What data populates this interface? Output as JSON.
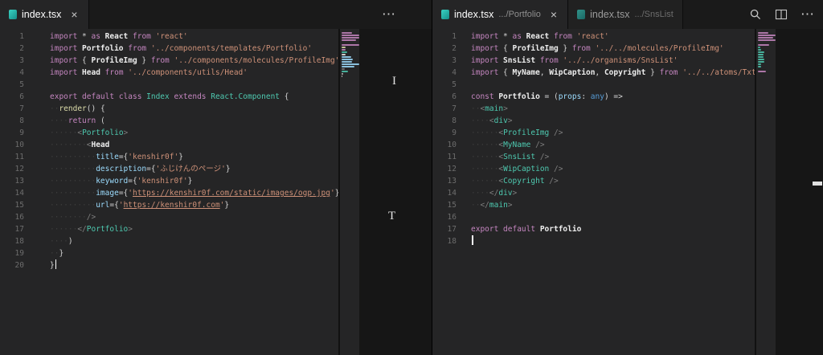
{
  "icons": {
    "close": "×",
    "more": "⋯"
  },
  "colors": {
    "keyword": "#c586c0",
    "string": "#ce9178",
    "component": "#4ec9b0",
    "attribute": "#9cdcfe",
    "type": "#569cd6",
    "editor_bg": "#252526"
  },
  "left_group": {
    "tabs": [
      {
        "title": "index.tsx",
        "active": true
      }
    ],
    "overlay_glyphs": [
      "I",
      "T"
    ],
    "editor": {
      "cursor_line": 20,
      "lines": [
        [
          [
            "kw",
            "import "
          ],
          [
            "pun",
            "* "
          ],
          [
            "kw",
            "as "
          ],
          [
            "id",
            "React "
          ],
          [
            "kw",
            "from "
          ],
          [
            "str",
            "'react'"
          ]
        ],
        [
          [
            "kw",
            "import "
          ],
          [
            "id",
            "Portfolio "
          ],
          [
            "kw",
            "from "
          ],
          [
            "str",
            "'../components/templates/Portfolio'"
          ]
        ],
        [
          [
            "kw",
            "import "
          ],
          [
            "pun",
            "{ "
          ],
          [
            "id",
            "ProfileImg"
          ],
          [
            "pun",
            " } "
          ],
          [
            "kw",
            "from "
          ],
          [
            "str",
            "'../components/molecules/ProfileImg'"
          ]
        ],
        [
          [
            "kw",
            "import "
          ],
          [
            "id",
            "Head "
          ],
          [
            "kw",
            "from "
          ],
          [
            "str",
            "'../components/utils/Head'"
          ]
        ],
        [],
        [
          [
            "kw",
            "export "
          ],
          [
            "kw",
            "default "
          ],
          [
            "kw",
            "class "
          ],
          [
            "comp",
            "Index "
          ],
          [
            "kw",
            "extends "
          ],
          [
            "comp",
            "React.Component "
          ],
          [
            "pun",
            "{"
          ]
        ],
        [
          [
            "ws",
            "··"
          ],
          [
            "fn",
            "render"
          ],
          [
            "pun",
            "() {"
          ]
        ],
        [
          [
            "ws",
            "····"
          ],
          [
            "kw",
            "return "
          ],
          [
            "pun",
            "("
          ]
        ],
        [
          [
            "ws",
            "······"
          ],
          [
            "tag",
            "<"
          ],
          [
            "comp",
            "Portfolio"
          ],
          [
            "tag",
            ">"
          ]
        ],
        [
          [
            "ws",
            "········"
          ],
          [
            "tag",
            "<"
          ],
          [
            "id",
            "Head"
          ]
        ],
        [
          [
            "ws",
            "··········"
          ],
          [
            "attr",
            "title"
          ],
          [
            "pun",
            "={"
          ],
          [
            "str",
            "'kenshir0f'"
          ],
          [
            "pun",
            "}"
          ]
        ],
        [
          [
            "ws",
            "··········"
          ],
          [
            "attr",
            "description"
          ],
          [
            "pun",
            "={"
          ],
          [
            "str",
            "'ふじけんのページ'"
          ],
          [
            "pun",
            "}"
          ]
        ],
        [
          [
            "ws",
            "··········"
          ],
          [
            "attr",
            "keyword"
          ],
          [
            "pun",
            "={"
          ],
          [
            "str",
            "'kenshir0f'"
          ],
          [
            "pun",
            "}"
          ]
        ],
        [
          [
            "ws",
            "··········"
          ],
          [
            "attr",
            "image"
          ],
          [
            "pun",
            "={"
          ],
          [
            "str",
            "'"
          ],
          [
            "link",
            "https://kenshir0f.com/static/images/ogp.jpg"
          ],
          [
            "str",
            "'"
          ],
          [
            "pun",
            "}"
          ]
        ],
        [
          [
            "ws",
            "··········"
          ],
          [
            "attr",
            "url"
          ],
          [
            "pun",
            "={"
          ],
          [
            "str",
            "'"
          ],
          [
            "link",
            "https://kenshir0f.com"
          ],
          [
            "str",
            "'"
          ],
          [
            "pun",
            "}"
          ]
        ],
        [
          [
            "ws",
            "········"
          ],
          [
            "tag",
            "/>"
          ]
        ],
        [
          [
            "ws",
            "······"
          ],
          [
            "tag",
            "</"
          ],
          [
            "comp",
            "Portfolio"
          ],
          [
            "tag",
            ">"
          ]
        ],
        [
          [
            "ws",
            "····"
          ],
          [
            "pun",
            ")"
          ]
        ],
        [
          [
            "ws",
            "··"
          ],
          [
            "pun",
            "}"
          ]
        ],
        [
          [
            "pun",
            "}"
          ]
        ]
      ]
    }
  },
  "right_group": {
    "tabs": [
      {
        "title": "index.tsx",
        "description": ".../Portfolio",
        "active": true
      },
      {
        "title": "index.tsx",
        "description": ".../SnsList",
        "active": false
      }
    ],
    "editor": {
      "cursor_line": 18,
      "lines": [
        [
          [
            "kw",
            "import "
          ],
          [
            "pun",
            "* "
          ],
          [
            "kw",
            "as "
          ],
          [
            "id",
            "React "
          ],
          [
            "kw",
            "from "
          ],
          [
            "str",
            "'react'"
          ]
        ],
        [
          [
            "kw",
            "import "
          ],
          [
            "pun",
            "{ "
          ],
          [
            "id",
            "ProfileImg"
          ],
          [
            "pun",
            " } "
          ],
          [
            "kw",
            "from "
          ],
          [
            "str",
            "'../../molecules/ProfileImg'"
          ]
        ],
        [
          [
            "kw",
            "import "
          ],
          [
            "id",
            "SnsList "
          ],
          [
            "kw",
            "from "
          ],
          [
            "str",
            "'../../organisms/SnsList'"
          ]
        ],
        [
          [
            "kw",
            "import "
          ],
          [
            "pun",
            "{ "
          ],
          [
            "id",
            "MyName"
          ],
          [
            "pun",
            ", "
          ],
          [
            "id",
            "WipCaption"
          ],
          [
            "pun",
            ", "
          ],
          [
            "id",
            "Copyright"
          ],
          [
            "pun",
            " } "
          ],
          [
            "kw",
            "from "
          ],
          [
            "str",
            "'../../atoms/Txt'"
          ]
        ],
        [],
        [
          [
            "kw",
            "const "
          ],
          [
            "id",
            "Portfolio "
          ],
          [
            "pun",
            "= ("
          ],
          [
            "attr",
            "props"
          ],
          [
            "pun",
            ": "
          ],
          [
            "type",
            "any"
          ],
          [
            "pun",
            ") =>"
          ]
        ],
        [
          [
            "ws",
            "··"
          ],
          [
            "tag",
            "<"
          ],
          [
            "comp",
            "main"
          ],
          [
            "tag",
            ">"
          ]
        ],
        [
          [
            "ws",
            "····"
          ],
          [
            "tag",
            "<"
          ],
          [
            "comp",
            "div"
          ],
          [
            "tag",
            ">"
          ]
        ],
        [
          [
            "ws",
            "······"
          ],
          [
            "tag",
            "<"
          ],
          [
            "comp",
            "ProfileImg"
          ],
          [
            "tag",
            " />"
          ]
        ],
        [
          [
            "ws",
            "······"
          ],
          [
            "tag",
            "<"
          ],
          [
            "comp",
            "MyName"
          ],
          [
            "tag",
            " />"
          ]
        ],
        [
          [
            "ws",
            "······"
          ],
          [
            "tag",
            "<"
          ],
          [
            "comp",
            "SnsList"
          ],
          [
            "tag",
            " />"
          ]
        ],
        [
          [
            "ws",
            "······"
          ],
          [
            "tag",
            "<"
          ],
          [
            "comp",
            "WipCaption"
          ],
          [
            "tag",
            " />"
          ]
        ],
        [
          [
            "ws",
            "······"
          ],
          [
            "tag",
            "<"
          ],
          [
            "comp",
            "Copyright"
          ],
          [
            "tag",
            " />"
          ]
        ],
        [
          [
            "ws",
            "····"
          ],
          [
            "tag",
            "</"
          ],
          [
            "comp",
            "div"
          ],
          [
            "tag",
            ">"
          ]
        ],
        [
          [
            "ws",
            "··"
          ],
          [
            "tag",
            "</"
          ],
          [
            "comp",
            "main"
          ],
          [
            "tag",
            ">"
          ]
        ],
        [],
        [
          [
            "kw",
            "export "
          ],
          [
            "kw",
            "default "
          ],
          [
            "id",
            "Portfolio"
          ]
        ],
        []
      ]
    }
  }
}
